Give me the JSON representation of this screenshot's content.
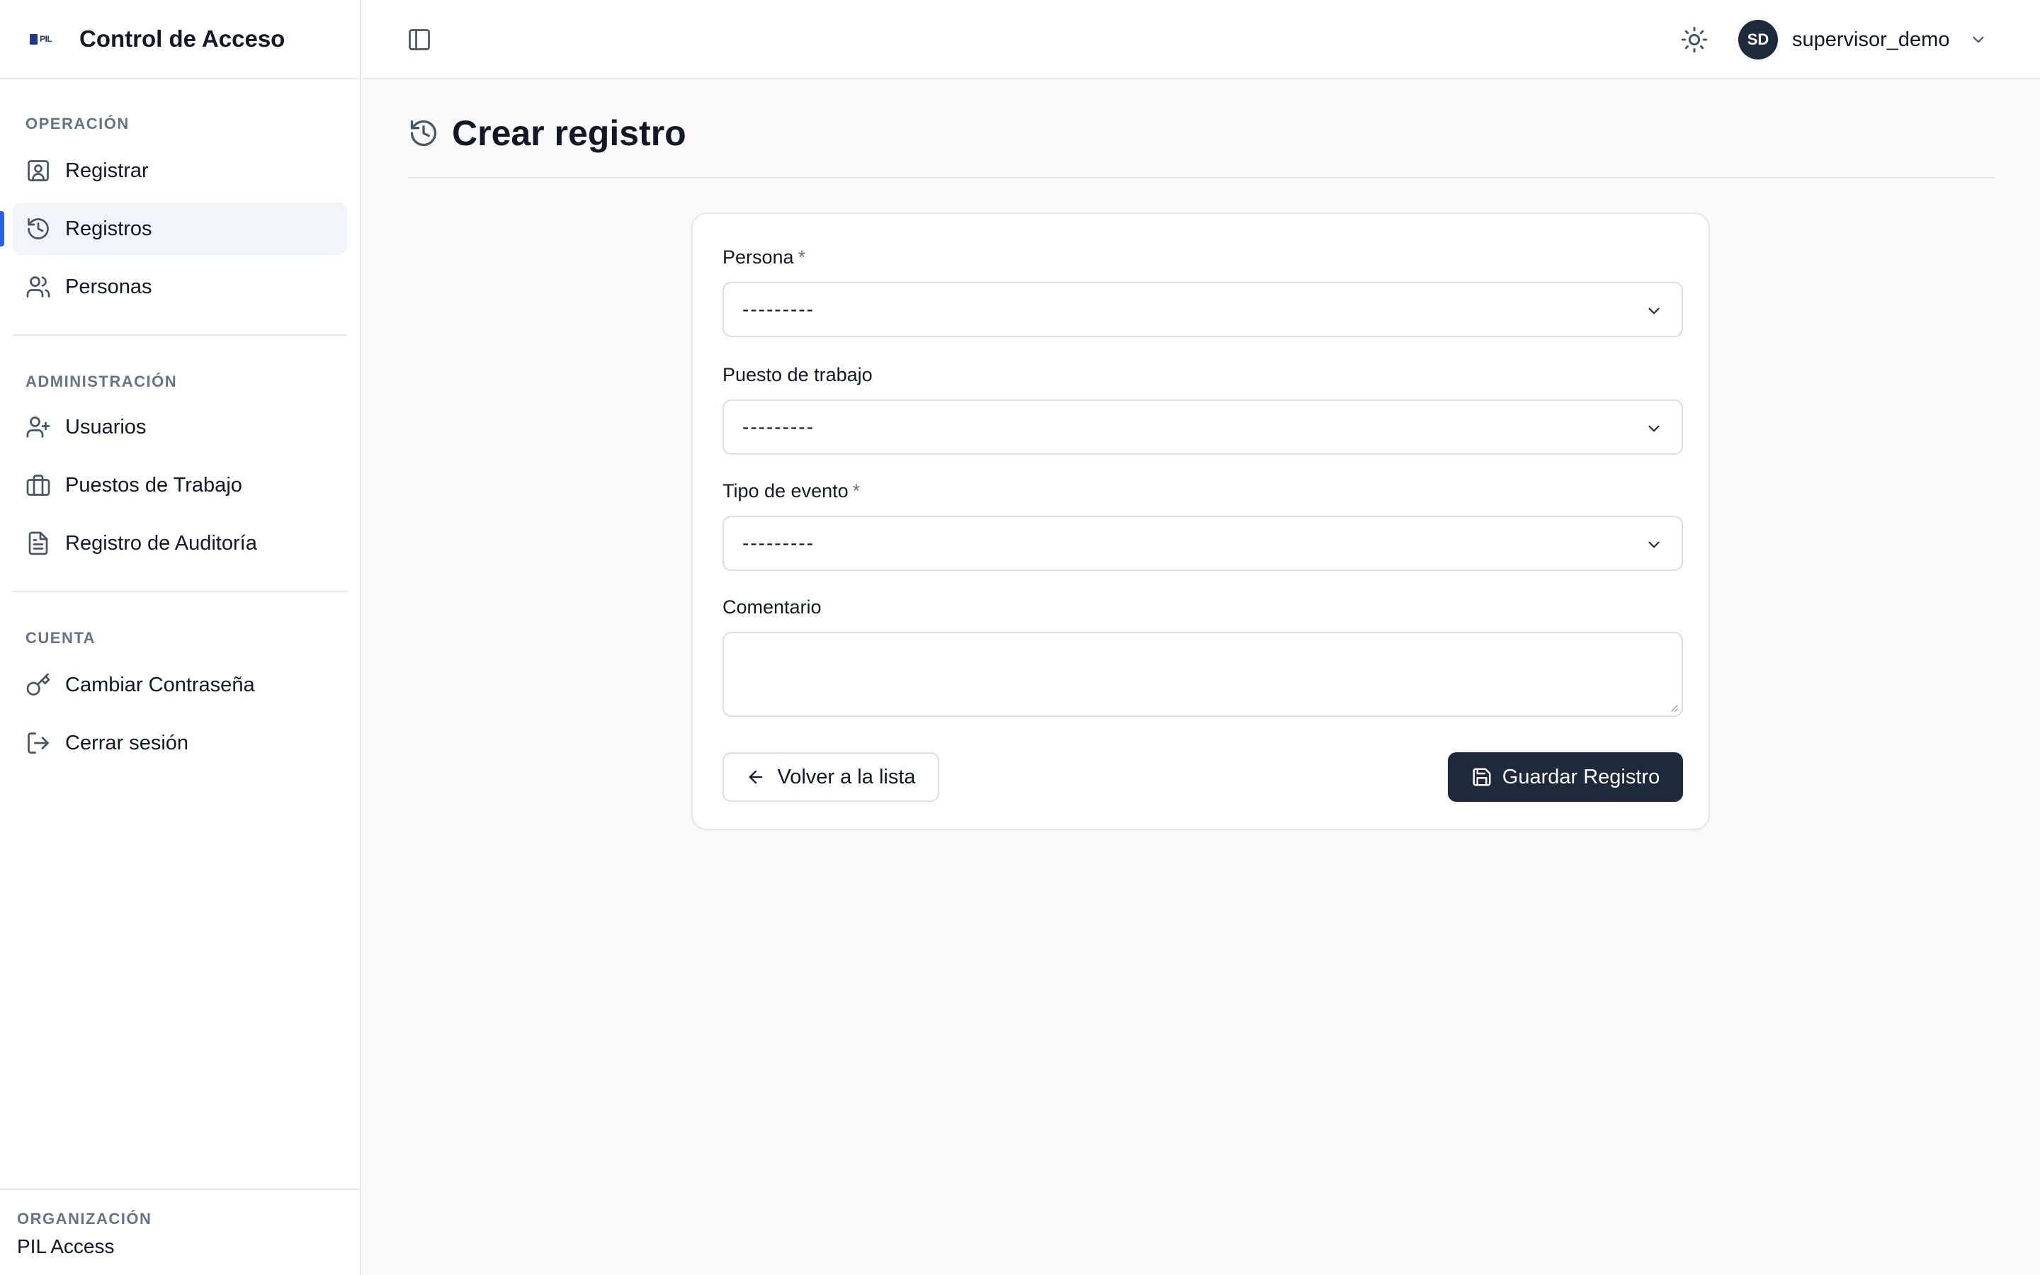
{
  "app": {
    "brand_logo_text": "PIL",
    "title": "Control de Acceso"
  },
  "sidebar": {
    "sections": [
      {
        "label": "OPERACIÓN",
        "items": [
          {
            "label": "Registrar",
            "icon": "contact-icon"
          },
          {
            "label": "Registros",
            "icon": "history-icon",
            "active": true
          },
          {
            "label": "Personas",
            "icon": "users-icon"
          }
        ]
      },
      {
        "label": "ADMINISTRACIÓN",
        "items": [
          {
            "label": "Usuarios",
            "icon": "user-plus-icon"
          },
          {
            "label": "Puestos de Trabajo",
            "icon": "briefcase-icon"
          },
          {
            "label": "Registro de Auditoría",
            "icon": "file-text-icon"
          }
        ]
      },
      {
        "label": "CUENTA",
        "items": [
          {
            "label": "Cambiar Contraseña",
            "icon": "key-icon"
          },
          {
            "label": "Cerrar sesión",
            "icon": "logout-icon"
          }
        ]
      }
    ],
    "organization": {
      "label": "ORGANIZACIÓN",
      "name": "PIL Access"
    }
  },
  "topbar": {
    "user": {
      "initials": "SD",
      "name": "supervisor_demo"
    }
  },
  "page": {
    "title": "Crear registro"
  },
  "form": {
    "persona": {
      "label": "Persona",
      "required_mark": "*",
      "value": "---------"
    },
    "puesto": {
      "label": "Puesto de trabajo",
      "value": "---------"
    },
    "tipo_evento": {
      "label": "Tipo de evento",
      "required_mark": "*",
      "value": "---------"
    },
    "comentario": {
      "label": "Comentario",
      "value": ""
    },
    "back_label": "Volver a la lista",
    "save_label": "Guardar Registro"
  },
  "colors": {
    "accent": "#2563eb",
    "primary_button": "#1e293b",
    "avatar_bg": "#1e293b"
  }
}
